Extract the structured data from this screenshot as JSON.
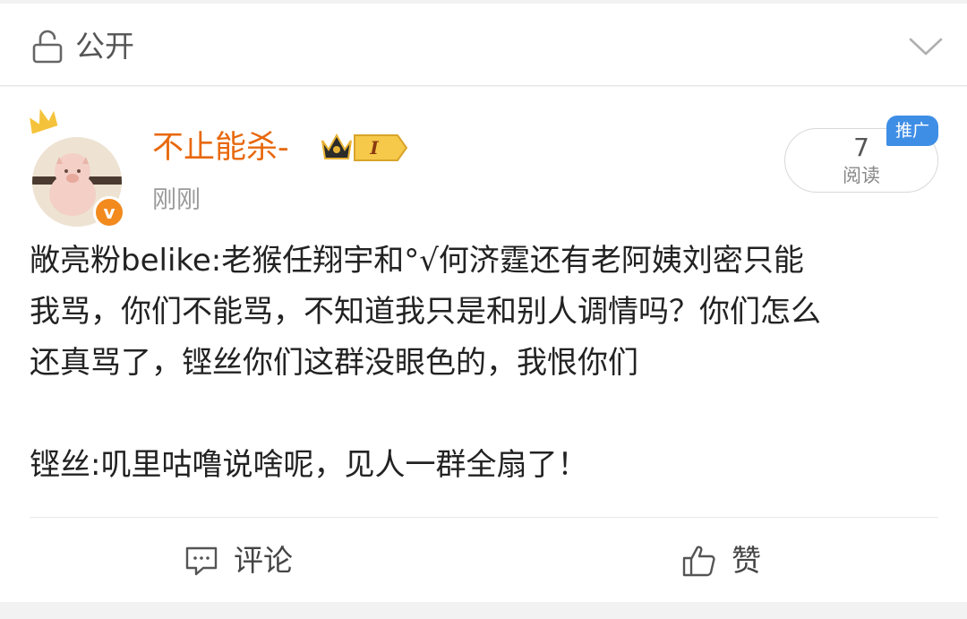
{
  "privacy": {
    "icon": "lock-open-icon",
    "label": "公开",
    "chevron": "chevron-down-icon"
  },
  "post": {
    "author": "不止能杀-",
    "vip_level": "I",
    "time": "刚刚",
    "read_count": "7",
    "read_label": "阅读",
    "promo_tag": "推广",
    "lines": [
      "敞亮粉belike:老猴任翔宇和°√何济霆还有老阿姨刘密只能",
      "我骂，你们不能骂，不知道我只是和别人调情吗？你们怎么",
      "还真骂了，铿丝你们这群没眼色的，我恨你们",
      "",
      "铿丝:叽里咕噜说啥呢，见人一群全扇了！"
    ]
  },
  "actions": {
    "comment_label": "评论",
    "like_label": "赞"
  },
  "colors": {
    "username": "#e8680c",
    "verified": "#f28a1e",
    "promo": "#3f8ee6"
  }
}
